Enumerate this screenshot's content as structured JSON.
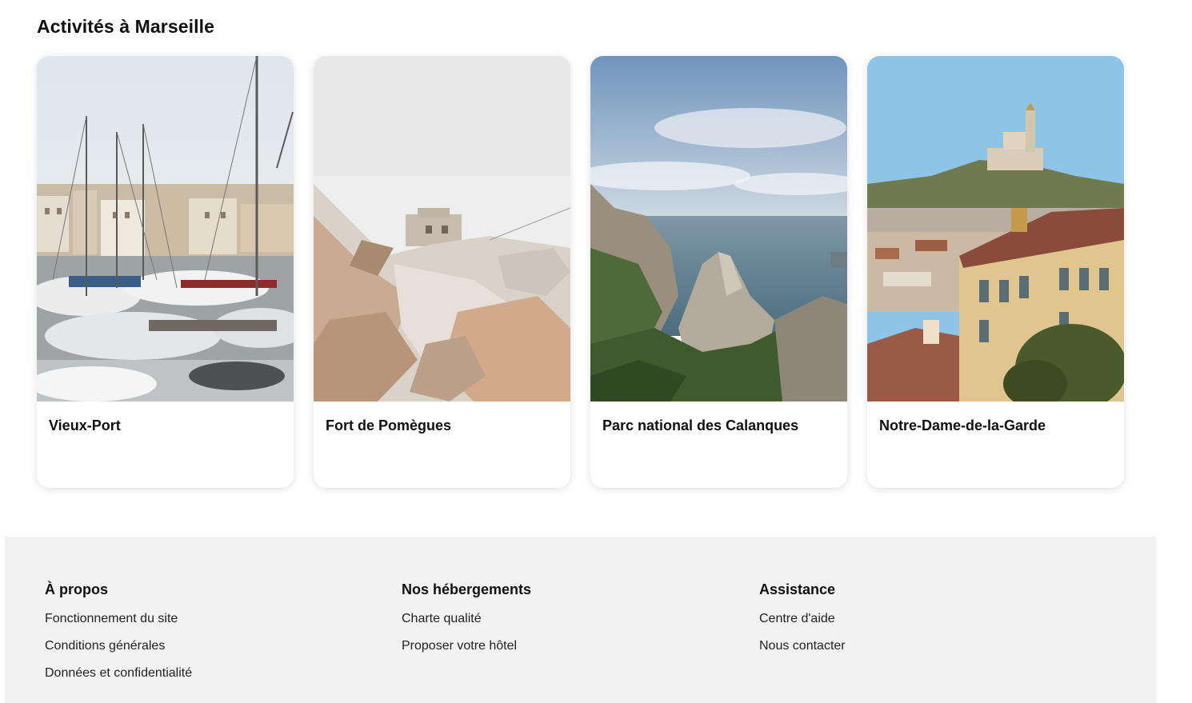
{
  "section": {
    "title": "Activités à Marseille"
  },
  "cards": [
    {
      "title": "Vieux-Port"
    },
    {
      "title": "Fort de Pomègues"
    },
    {
      "title": "Parc national des Calanques"
    },
    {
      "title": "Notre-Dame-de-la-Garde"
    }
  ],
  "footer": {
    "about": {
      "heading": "À propos",
      "links": [
        "Fonctionnement du site",
        "Conditions générales",
        "Données et confidentialité"
      ]
    },
    "lodging": {
      "heading": "Nos hébergements",
      "links": [
        "Charte qualité",
        "Proposer votre hôtel"
      ]
    },
    "support": {
      "heading": "Assistance",
      "links": [
        "Centre d'aide",
        "Nous contacter"
      ]
    }
  }
}
